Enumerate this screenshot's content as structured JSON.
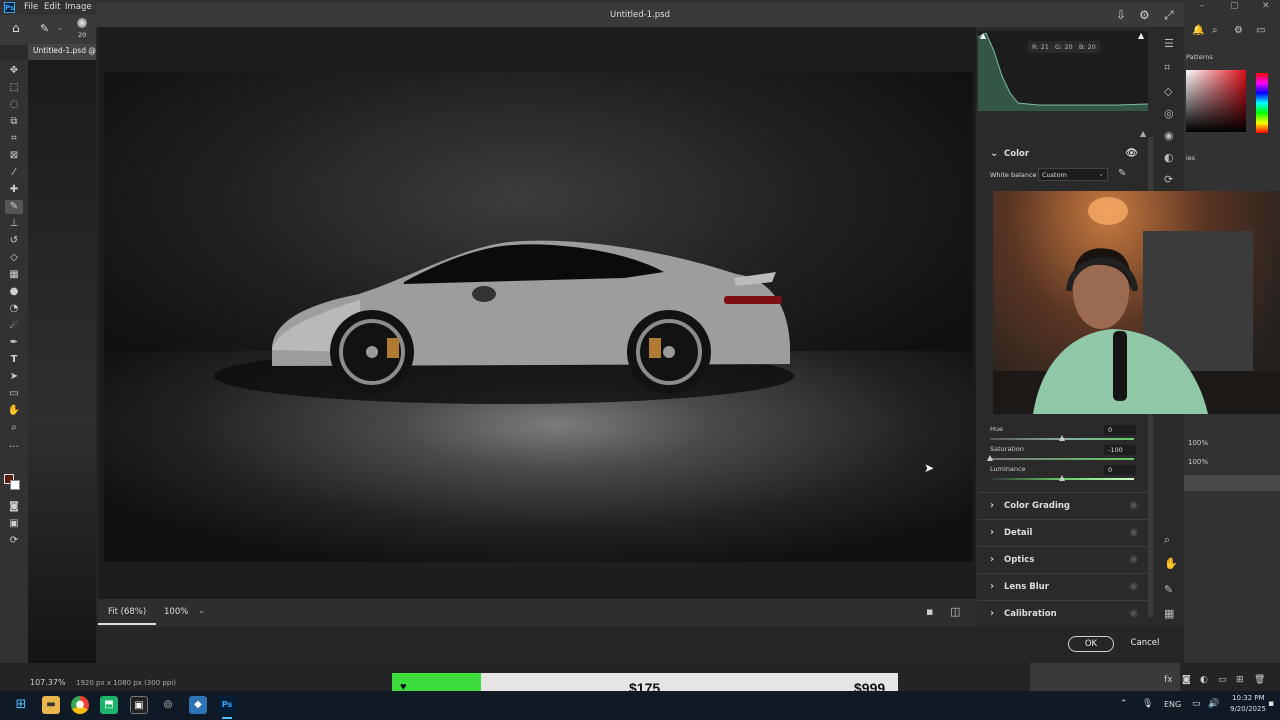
{
  "app": {
    "name": "Ps",
    "menus": [
      "File",
      "Edit",
      "Image"
    ],
    "brush_size": "20",
    "doc_tab": "Untitled-1.psd @"
  },
  "dialog": {
    "title": "Untitled-1.psd"
  },
  "histogram": {
    "r": "R: 21",
    "g": "G: 20",
    "b": "B: 20"
  },
  "color_section": {
    "title": "Color",
    "white_balance_label": "White balance",
    "white_balance_value": "Custom"
  },
  "hsl": [
    {
      "label": "Hue",
      "value": "0",
      "level": 0.5
    },
    {
      "label": "Saturation",
      "value": "-100",
      "level": 0.0
    },
    {
      "label": "Luminance",
      "value": "0",
      "level": 0.5
    }
  ],
  "sections": [
    "Color Grading",
    "Detail",
    "Optics",
    "Lens Blur",
    "Calibration"
  ],
  "status": {
    "fit": "Fit (68%)",
    "zoom": "100%"
  },
  "buttons": {
    "ok": "OK",
    "cancel": "Cancel"
  },
  "right_panel": {
    "patterns": "Patterns",
    "opacity1": "100%",
    "opacity2": "100%",
    "ies": "ies"
  },
  "ps_status": {
    "zoom": "107.37%",
    "doc_info": "1920 px x 1080 px (300 ppi)"
  },
  "pricebar": {
    "current": "$175",
    "target": "$999",
    "progress": 0.175
  },
  "taskbar": {
    "lang": "ENG",
    "time": "10:32 PM",
    "date": "9/20/2025"
  },
  "colors": {
    "accent": "#31a8ff",
    "progress_green": "#3ddc3d",
    "ok_border": "#cfcfcf"
  }
}
